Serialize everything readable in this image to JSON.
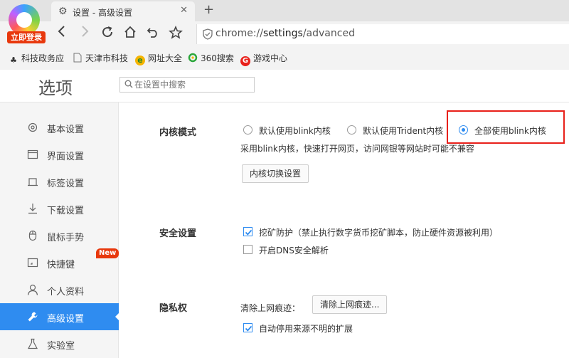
{
  "browser": {
    "login_badge": "立即登录",
    "tab": {
      "title": "设置 - 高级设置",
      "close": "✕"
    },
    "new_tab": "+",
    "url": {
      "prefix": "chrome://",
      "host": "settings",
      "path": "/advanced"
    },
    "bookmarks": [
      {
        "label": "科技政务应",
        "icon": "clover-icon"
      },
      {
        "label": "天津市科技",
        "icon": "page-icon"
      },
      {
        "label": "网址大全",
        "icon": "globe-icon"
      },
      {
        "label": "360搜索",
        "icon": "360-search-icon"
      },
      {
        "label": "游戏中心",
        "icon": "game-center-icon"
      }
    ]
  },
  "header": {
    "title": "选项",
    "search_placeholder": "在设置中搜索"
  },
  "sidebar": {
    "items": [
      {
        "label": "基本设置",
        "icon": "gear-icon"
      },
      {
        "label": "界面设置",
        "icon": "window-icon"
      },
      {
        "label": "标签设置",
        "icon": "tab-icon"
      },
      {
        "label": "下载设置",
        "icon": "download-icon"
      },
      {
        "label": "鼠标手势",
        "icon": "mouse-icon"
      },
      {
        "label": "快捷键",
        "icon": "keyboard-icon"
      },
      {
        "label": "个人资料",
        "icon": "person-icon"
      },
      {
        "label": "高级设置",
        "icon": "wrench-icon",
        "active": true
      },
      {
        "label": "实验室",
        "icon": "flask-icon"
      }
    ],
    "new_badge": "New"
  },
  "kernel": {
    "label": "内核模式",
    "options": [
      {
        "label": "默认使用blink内核",
        "checked": false
      },
      {
        "label": "默认使用Trident内核",
        "checked": false
      },
      {
        "label": "全部使用blink内核",
        "checked": true
      }
    ],
    "note": "采用blink内核，快速打开网页，访问网银等网站时可能不兼容",
    "switch_button": "内核切换设置"
  },
  "security": {
    "label": "安全设置",
    "options": [
      {
        "label": "挖矿防护（禁止执行数字货币挖矿脚本，防止硬件资源被利用）",
        "checked": true
      },
      {
        "label": "开启DNS安全解析",
        "checked": false
      }
    ]
  },
  "privacy": {
    "label": "隐私权",
    "clear_label": "清除上网痕迹：",
    "clear_button": "清除上网痕迹...",
    "options": [
      {
        "label": "自动停用来源不明的扩展",
        "checked": true
      }
    ]
  },
  "colors": {
    "accent": "#2f8cf0",
    "highlight_box": "#e8201a",
    "badge": "#e8380d"
  }
}
